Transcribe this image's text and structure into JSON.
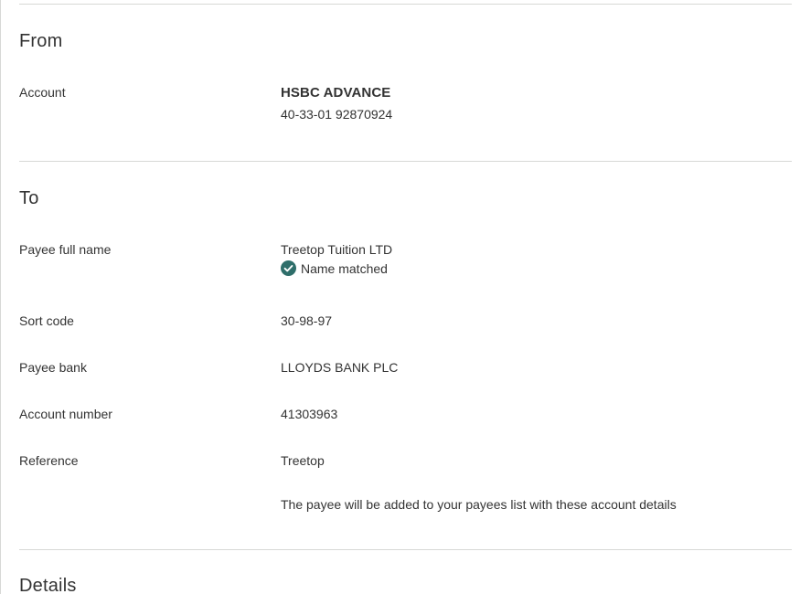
{
  "sections": {
    "from": {
      "title": "From",
      "account_label": "Account",
      "account_name": "HSBC ADVANCE",
      "account_details": "40-33-01 92870924"
    },
    "to": {
      "title": "To",
      "payee_name_label": "Payee full name",
      "payee_name": "Treetop Tuition LTD",
      "name_match_status": "Name matched",
      "name_match_icon": "check-circle-icon",
      "name_match_color": "#2e6e6a",
      "sort_code_label": "Sort code",
      "sort_code": "30-98-97",
      "payee_bank_label": "Payee bank",
      "payee_bank": "LLOYDS BANK PLC",
      "account_number_label": "Account number",
      "account_number": "41303963",
      "reference_label": "Reference",
      "reference": "Treetop",
      "note": "The payee will be added to your payees list with these account details"
    },
    "details": {
      "title": "Details"
    }
  }
}
